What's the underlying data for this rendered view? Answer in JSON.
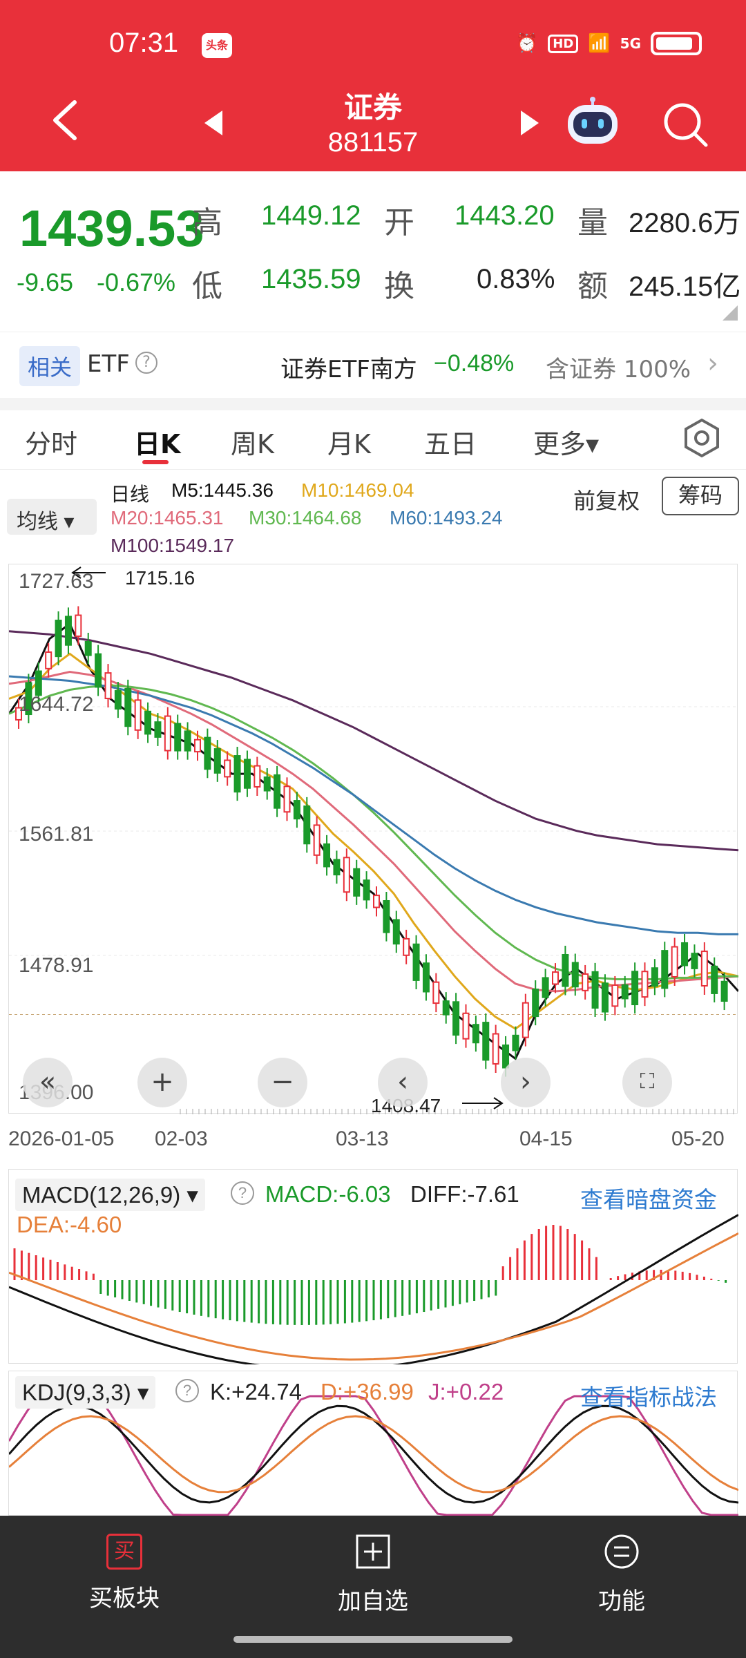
{
  "status": {
    "time": "07:31",
    "app_badge": "头条",
    "network": "5G",
    "hd": "HD"
  },
  "nav": {
    "title": "证券",
    "code": "881157"
  },
  "quote": {
    "price": "1439.53",
    "change": "-9.65",
    "change_pct": "-0.67%",
    "high_label": "高",
    "high": "1449.12",
    "low_label": "低",
    "low": "1435.59",
    "open_label": "开",
    "open": "1443.20",
    "turnover_label": "换",
    "turnover": "0.83%",
    "volume_label": "量",
    "volume": "2280.6万",
    "amount_label": "额",
    "amount": "245.15亿"
  },
  "etf": {
    "tag": "相关",
    "label": "ETF",
    "name": "证券ETF南方",
    "change": "−0.48%",
    "contains": "含证券 100%"
  },
  "tabs": [
    "分时",
    "日K",
    "周K",
    "月K",
    "五日",
    "更多▾"
  ],
  "legend": {
    "avg_button": "均线 ▾",
    "daily": "日线",
    "m5": "M5:1445.36",
    "m10": "M10:1469.04",
    "m20": "M20:1465.31",
    "m30": "M30:1464.68",
    "m60": "M60:1493.24",
    "m100": "M100:1549.17",
    "adjust": "前复权",
    "chips": "筹码"
  },
  "colors": {
    "up": "#e8303a",
    "down": "#1a9a2a",
    "m5": "#111111",
    "m10": "#e0a81c",
    "m20": "#e06a7a",
    "m30": "#60b850",
    "m60": "#3a7ab0",
    "m100": "#5a2a5a"
  },
  "chart_data": {
    "type": "candlestick",
    "y_ticks": [
      "1727.63",
      "1644.72",
      "1561.81",
      "1478.91",
      "1396.00"
    ],
    "ylim": [
      1396.0,
      1727.63
    ],
    "x_ticks": [
      "2026-01-05",
      "02-03",
      "03-13",
      "04-15",
      "05-20"
    ],
    "max_annotation": "1715.16",
    "min_annotation": "1408.47",
    "series": [
      {
        "name": "M5",
        "values": [
          1640,
          1660,
          1690,
          1700,
          1670,
          1650,
          1640,
          1630,
          1625,
          1620,
          1610,
          1600,
          1600,
          1590,
          1580,
          1560,
          1540,
          1530,
          1520,
          1500,
          1480,
          1460,
          1440,
          1430,
          1420,
          1410,
          1440,
          1460,
          1470,
          1460,
          1450,
          1455,
          1460,
          1470,
          1480,
          1470,
          1455
        ]
      },
      {
        "name": "M10",
        "values": [
          1650,
          1655,
          1670,
          1680,
          1670,
          1660,
          1650,
          1640,
          1635,
          1628,
          1620,
          1612,
          1605,
          1598,
          1590,
          1575,
          1560,
          1548,
          1535,
          1520,
          1500,
          1482,
          1465,
          1450,
          1438,
          1430,
          1440,
          1450,
          1460,
          1462,
          1458,
          1456,
          1458,
          1462,
          1466,
          1468,
          1465
        ]
      },
      {
        "name": "M20",
        "values": [
          1660,
          1662,
          1665,
          1668,
          1666,
          1662,
          1657,
          1652,
          1646,
          1640,
          1633,
          1625,
          1617,
          1609,
          1600,
          1590,
          1578,
          1566,
          1553,
          1540,
          1525,
          1510,
          1495,
          1482,
          1470,
          1460,
          1456,
          1455,
          1456,
          1458,
          1459,
          1460,
          1461,
          1462,
          1463,
          1464,
          1465
        ]
      },
      {
        "name": "M30",
        "values": [
          1640,
          1646,
          1652,
          1656,
          1658,
          1659,
          1658,
          1656,
          1653,
          1649,
          1644,
          1638,
          1631,
          1624,
          1616,
          1607,
          1597,
          1586,
          1574,
          1561,
          1547,
          1533,
          1519,
          1506,
          1494,
          1484,
          1476,
          1470,
          1466,
          1464,
          1463,
          1463,
          1463,
          1464,
          1464,
          1465,
          1465
        ]
      },
      {
        "name": "M60",
        "values": [
          1665,
          1664,
          1663,
          1662,
          1660,
          1658,
          1655,
          1652,
          1648,
          1644,
          1639,
          1633,
          1627,
          1620,
          1612,
          1604,
          1595,
          1586,
          1576,
          1566,
          1556,
          1546,
          1537,
          1529,
          1522,
          1516,
          1511,
          1507,
          1504,
          1501,
          1499,
          1497,
          1495,
          1494,
          1494,
          1493,
          1493
        ]
      },
      {
        "name": "M100",
        "values": [
          1695,
          1694,
          1693,
          1691,
          1689,
          1686,
          1683,
          1680,
          1676,
          1672,
          1668,
          1664,
          1659,
          1654,
          1649,
          1643,
          1637,
          1631,
          1624,
          1617,
          1610,
          1603,
          1596,
          1589,
          1582,
          1576,
          1570,
          1566,
          1562,
          1559,
          1557,
          1555,
          1553,
          1552,
          1551,
          1550,
          1549
        ]
      }
    ]
  },
  "macd": {
    "selector": "MACD(12,26,9) ▾",
    "macd": "MACD:-6.03",
    "diff": "DIFF:-7.61",
    "dea": "DEA:-4.60",
    "link": "查看暗盘资金"
  },
  "kdj": {
    "selector": "KDJ(9,3,3) ▾",
    "k": "K:+24.74",
    "d": "D:+36.99",
    "j": "J:+0.22",
    "link": "查看指标战法"
  },
  "bottom": {
    "buy": "买板块",
    "buy_icon": "买",
    "add": "加自选",
    "func": "功能"
  }
}
